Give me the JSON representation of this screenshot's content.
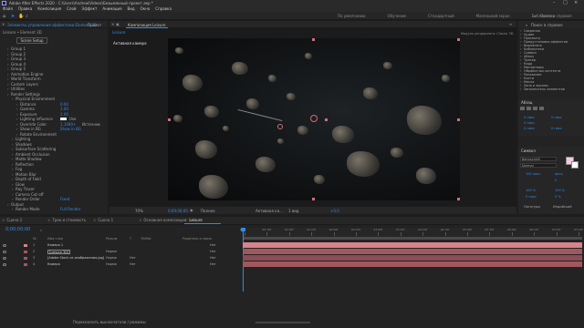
{
  "window": {
    "title": "Adobe After Effects 2020 - C:\\Users\\Andrew\\Videos\\Безымянный проект.aep *",
    "controls": [
      "–",
      "□",
      "×"
    ]
  },
  "menu": [
    "Файл",
    "Правка",
    "Композиция",
    "Слой",
    "Эффект",
    "Анимация",
    "Вид",
    "Окно",
    "Справка"
  ],
  "toolbar": {
    "workspaces": [
      "По умолчанию",
      "Обучение",
      "Стандартный",
      "Маленький экран",
      "Библиотеки"
    ],
    "search_placeholder": "Поиск в справке"
  },
  "effects_panel": {
    "header": "Элементы управления эффектами Element 3D",
    "tab_project": "Проект",
    "subheader": "Leisure • Element 3D",
    "scene_setup_button": "Scene Setup",
    "items": [
      "Group 1",
      "Group 2",
      "Group 3",
      "Group 4",
      "Group 5",
      "Animation Engine",
      "World Transform",
      "Custom Layers",
      "Utilities",
      "Render Settings",
      "Physical Environment",
      "Distance",
      "Gamma",
      "Exposure",
      "Lighting Influence",
      "Override Color",
      "Show in BG",
      "Rotate Environment",
      "Lighting",
      "Shadows",
      "Subsurface Scattering",
      "Ambient Occlusion",
      "Matte Shadow",
      "Reflection",
      "Fog",
      "Motion Blur",
      "Depth of Field",
      "Glow",
      "Ray Tracer",
      "Camera Cut-off",
      "Render Order",
      "Output",
      "Render Mode"
    ],
    "values": {
      "distance": "0.00",
      "gamma": "1.00",
      "exposure": "1.00",
      "override_color_label": "Use",
      "show_in_bg": "Show in BG",
      "resolution": "1.1080+",
      "source": "Источник",
      "render_order": "Fixed",
      "render_mode": "Full Render"
    }
  },
  "composition_panel": {
    "tab": "Композиция Leisure",
    "breadcrumb": "Leisure",
    "layer_label": "Активная камера",
    "renderer": "Модуль рендеринга: Classic 3D",
    "footer": {
      "zoom": "70%",
      "timecode": "0;00;00;00",
      "resolution": "Полное",
      "camera": "Активная ка...",
      "views": "1 вид",
      "offset": "+0.0"
    }
  },
  "right_panel": {
    "search_placeholder": "Поиск в справке",
    "list": [
      "Сведения",
      "Аудио",
      "Просмотр",
      "Предустановки эффектов",
      "Выровнять",
      "Библиотеки",
      "Символ",
      "Абзац",
      "Трекер",
      "Кадр",
      "Миниатюры",
      "Обработчик контента",
      "Рисование",
      "Кисти",
      "Маска",
      "Зона и экраны",
      "Заполнитель элементов"
    ],
    "paragraph_title": "Абзац",
    "para_values": [
      "0 пикс",
      "0 пикс",
      "0 пикс",
      "0 пикс",
      "0 пикс"
    ],
    "character_title": "Символ",
    "font": "Bahnschrift",
    "style": "Normal",
    "size": "100 пикс",
    "leading": "Авто",
    "tracking": "0",
    "scale_v": "100 %",
    "scale_h": "100 %",
    "baseline": "0 пикс",
    "tsume": "0 %",
    "ligatures": "Лигатуры",
    "hindi": "Индийский"
  },
  "timeline": {
    "tabs": [
      "Сцена 2",
      "Трек и стоимость",
      "Сцена 1",
      "Основная композиция",
      "Leisure"
    ],
    "active_tab": "Leisure",
    "timecode": "0;00;00;00",
    "columns": [
      "№",
      "Имя слоя",
      "Режим",
      "T",
      "TrkMat",
      "Родитель и связь"
    ],
    "layers": [
      {
        "num": "1",
        "name": "Камера 1",
        "mode": "",
        "trk": "",
        "parent": "Нет"
      },
      {
        "num": "2",
        "name": "[Leisure 3D]",
        "mode": "Норма",
        "trk": "",
        "parent": "Нет"
      },
      {
        "num": "3",
        "name": "[Adobe Stock из изображения.jpg]",
        "mode": "Норма",
        "trk": "Нет",
        "parent": "Нет"
      },
      {
        "num": "4",
        "name": "Камера",
        "mode": "Норма",
        "trk": "Нет",
        "parent": "Нет"
      }
    ],
    "ruler": [
      "0f",
      "00:15f",
      "01:00f",
      "01:15f",
      "02:00f",
      "02:15f",
      "03:00f",
      "03:15f",
      "04:00f",
      "04:15f",
      "05:00f",
      "05:15f",
      "06:00f",
      "06:15f",
      "07:00f",
      "07:15f"
    ],
    "footer": "Переключить выключатели / режимы"
  },
  "colors": {
    "accent": "#2d8ceb",
    "layer_track": "#a0585e",
    "layer_track_2": "#8a4e53",
    "camera_track": "#d6838a"
  }
}
